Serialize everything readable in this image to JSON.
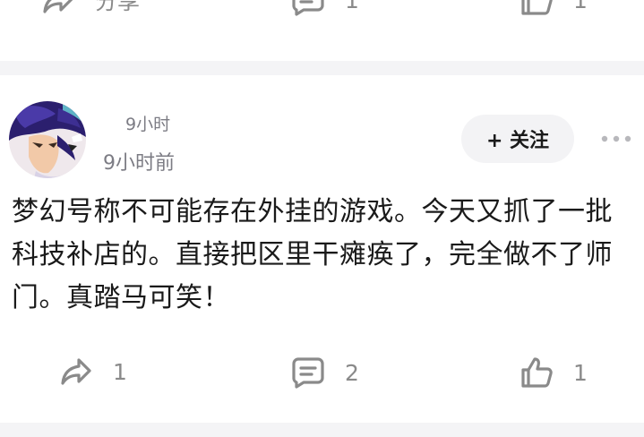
{
  "prev_post": {
    "share_label": "分享",
    "comment_count": "1",
    "like_count": "1"
  },
  "post": {
    "author_name": "9小时",
    "time": "9小时前",
    "follow_label": "+ 关注",
    "text": "梦幻号称不可能存在外挂的游戏。今天又抓了一批科技补店的。直接把区里干瘫痪了，完全做不了师门。真踏马可笑！",
    "share_count": "1",
    "comment_count": "2",
    "like_count": "1"
  },
  "icons": {
    "share": "share-arrow-icon",
    "comment": "comment-icon",
    "like": "thumbs-up-icon",
    "more": "more-dots-icon"
  },
  "colors": {
    "divider": "#f4f4f6",
    "icon": "#8a8a8a",
    "follow_bg": "#f3f3f5"
  }
}
